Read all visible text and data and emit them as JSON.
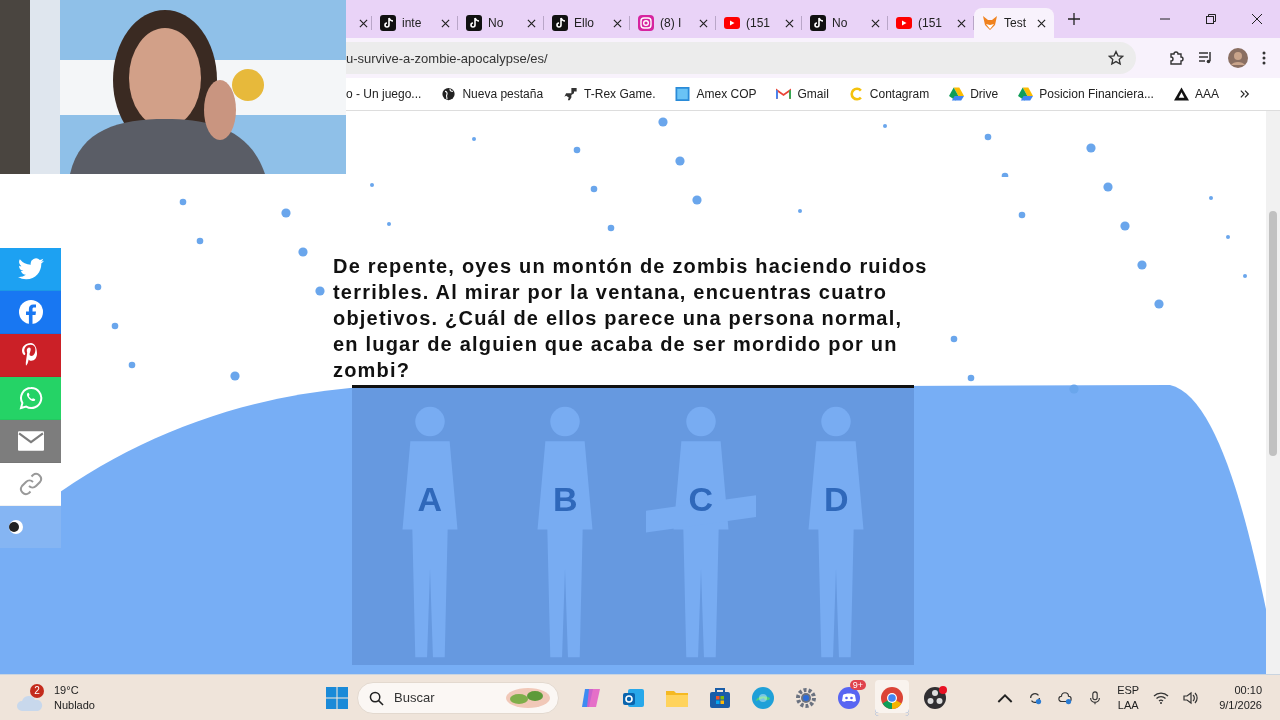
{
  "tabs": [
    {
      "kind": "partial",
      "selected": false
    },
    {
      "kind": "note",
      "title": "inte",
      "selected": false
    },
    {
      "kind": "note",
      "title": "No",
      "selected": false
    },
    {
      "kind": "note",
      "title": "Ello",
      "selected": false
    },
    {
      "kind": "camera",
      "title": "(8) I",
      "selected": false
    },
    {
      "kind": "play",
      "title": "(151",
      "selected": false
    },
    {
      "kind": "note",
      "title": "No",
      "selected": false
    },
    {
      "kind": "play",
      "title": "(151",
      "selected": false
    },
    {
      "kind": "fox",
      "title": "Test",
      "selected": true
    }
  ],
  "address_bar": {
    "value": "u-survive-a-zombie-apocalypse/es/"
  },
  "bookmarks": [
    {
      "kind": "none",
      "label": "o - Un juego..."
    },
    {
      "kind": "globe",
      "label": "Nueva pestaña"
    },
    {
      "kind": "dino",
      "label": "T-Rex Game."
    },
    {
      "kind": "square",
      "label": "Amex COP"
    },
    {
      "kind": "mail",
      "label": "Gmail"
    },
    {
      "kind": "ring",
      "label": "Contagram"
    },
    {
      "kind": "drive",
      "label": "Drive"
    },
    {
      "kind": "drive",
      "label": "Posicion Financiera..."
    },
    {
      "kind": "triangle",
      "label": "AAA"
    }
  ],
  "share_bar": [
    {
      "kind": "twitter",
      "color": "#1da1f2"
    },
    {
      "kind": "facebook",
      "color": "#1877f2"
    },
    {
      "kind": "pinterest",
      "color": "#cb2027"
    },
    {
      "kind": "whatsapp",
      "color": "#25d366"
    },
    {
      "kind": "email",
      "color": "#7d7d7d"
    },
    {
      "kind": "link",
      "color": "#ffffff"
    }
  ],
  "question": "De repente, oyes un montón de zombis haciendo ruidos terribles. Al mirar por la ventana, encuentras cuatro objetivos. ¿Cuál de ellos parece una persona normal, en lugar de alguien que acaba de ser mordido por un zombi?",
  "options": [
    "A",
    "B",
    "C",
    "D"
  ],
  "theme_toggle": {
    "on": false
  },
  "taskbar": {
    "weather": {
      "temperature": "19°C",
      "condition": "Nublado",
      "badge": "2"
    },
    "search": {
      "placeholder": "Buscar"
    },
    "apps": [
      {
        "kind": "copilot",
        "selected": false
      },
      {
        "kind": "outlook",
        "selected": false
      },
      {
        "kind": "folder",
        "selected": false
      },
      {
        "kind": "store",
        "selected": false
      },
      {
        "kind": "edge",
        "selected": false
      },
      {
        "kind": "settings",
        "selected": false
      },
      {
        "kind": "discord",
        "badge": "9+",
        "selected": false
      },
      {
        "kind": "chrome",
        "selected": true
      },
      {
        "kind": "obs",
        "selected": false
      }
    ],
    "language": [
      "ESP",
      "LAA"
    ],
    "time": "00:10",
    "date": "9/1/2026"
  }
}
